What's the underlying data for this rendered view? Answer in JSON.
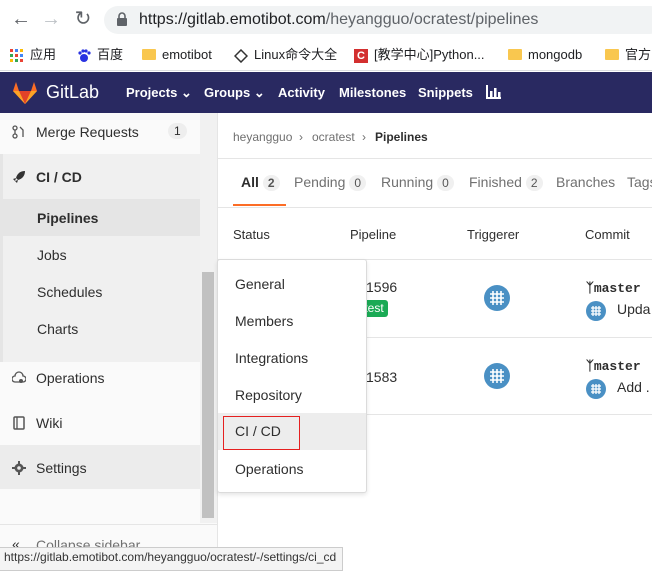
{
  "browser": {
    "url_host": "https://gitlab.emotibot.com",
    "url_path": "/heyangguo/ocratest/pipelines",
    "bookmarks": [
      {
        "label": "应用",
        "icon": "apps-grid-icon"
      },
      {
        "label": "百度",
        "icon": "baidu-paw-icon"
      },
      {
        "label": "emotibot",
        "icon": "folder-icon"
      },
      {
        "label": "Linux命令大全",
        "icon": "diamond-icon"
      },
      {
        "label": "[教学中心]Python...",
        "icon": "c-logo-icon"
      },
      {
        "label": "mongodb",
        "icon": "folder-icon"
      },
      {
        "label": "官方",
        "icon": "folder-icon"
      }
    ]
  },
  "header": {
    "brand": "GitLab",
    "nav": [
      "Projects",
      "Groups",
      "Activity",
      "Milestones",
      "Snippets"
    ]
  },
  "sidebar": {
    "merge_requests": {
      "label": "Merge Requests",
      "count": "1"
    },
    "cicd": "CI / CD",
    "sub": [
      "Pipelines",
      "Jobs",
      "Schedules",
      "Charts"
    ],
    "operations": "Operations",
    "wiki": "Wiki",
    "settings": "Settings",
    "collapse": "Collapse sidebar"
  },
  "breadcrumb": [
    "heyangguo",
    "ocratest",
    "Pipelines"
  ],
  "tabs": [
    {
      "label": "All",
      "count": "2"
    },
    {
      "label": "Pending",
      "count": "0"
    },
    {
      "label": "Running",
      "count": "0"
    },
    {
      "label": "Finished",
      "count": "2"
    },
    {
      "label": "Branches",
      "count": ""
    },
    {
      "label": "Tags",
      "count": ""
    }
  ],
  "table": {
    "headers": [
      "Status",
      "Pipeline",
      "Triggerer",
      "Commit"
    ],
    "rows": [
      {
        "pipeline": "1596",
        "tag": "test",
        "branch": "master",
        "commit": "Upda"
      },
      {
        "pipeline": "1583",
        "tag": "",
        "branch": "master",
        "commit": "Add ."
      }
    ]
  },
  "dropdown": [
    "General",
    "Members",
    "Integrations",
    "Repository",
    "CI / CD",
    "Operations"
  ],
  "status_url": "https://gitlab.emotibot.com/heyangguo/ocratest/-/settings/ci_cd",
  "colors": {
    "header": "#292961",
    "accent": "#e24329",
    "success": "#1aaa55",
    "highlight_border": "#e52020"
  }
}
